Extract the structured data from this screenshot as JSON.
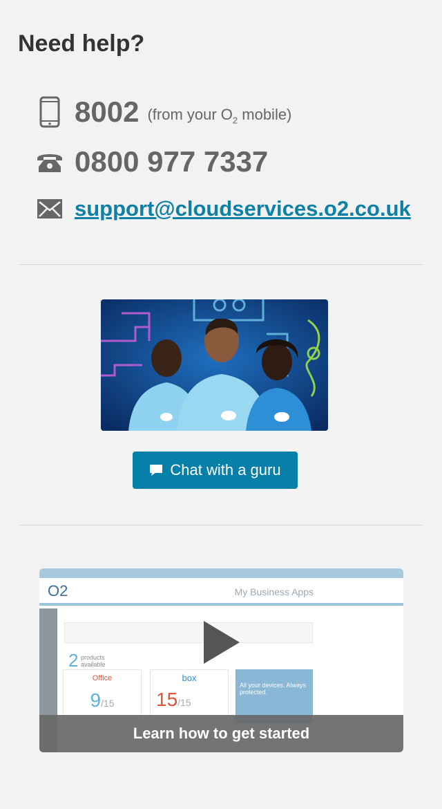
{
  "help": {
    "title": "Need help?"
  },
  "contacts": {
    "mobile_number": "8002",
    "mobile_note_prefix": "(from your O",
    "mobile_note_sub": "2",
    "mobile_note_suffix": " mobile)",
    "landline_number": "0800 977 7337",
    "email": "support@cloudservices.o2.co.uk"
  },
  "chat": {
    "button_label": "Chat with a guru"
  },
  "video": {
    "caption": "Learn how to get started",
    "preview_logo": "O2",
    "preview_title": "My Business Apps",
    "preview_count": "2",
    "preview_count_label": "products available",
    "preview_card1_num": "9",
    "preview_card1_den": "/15",
    "preview_card2_num": "15",
    "preview_card2_den": "/15",
    "preview_card2_brand": "box",
    "preview_card1_brand": "Office",
    "preview_promo": "All your devices. Always protected."
  },
  "colors": {
    "accent": "#0680a8",
    "link": "#0c80a6",
    "background": "#f2f2f2"
  },
  "icons": [
    "mobile-phone-icon",
    "telephone-icon",
    "envelope-icon",
    "chat-bubble-icon",
    "play-icon"
  ]
}
